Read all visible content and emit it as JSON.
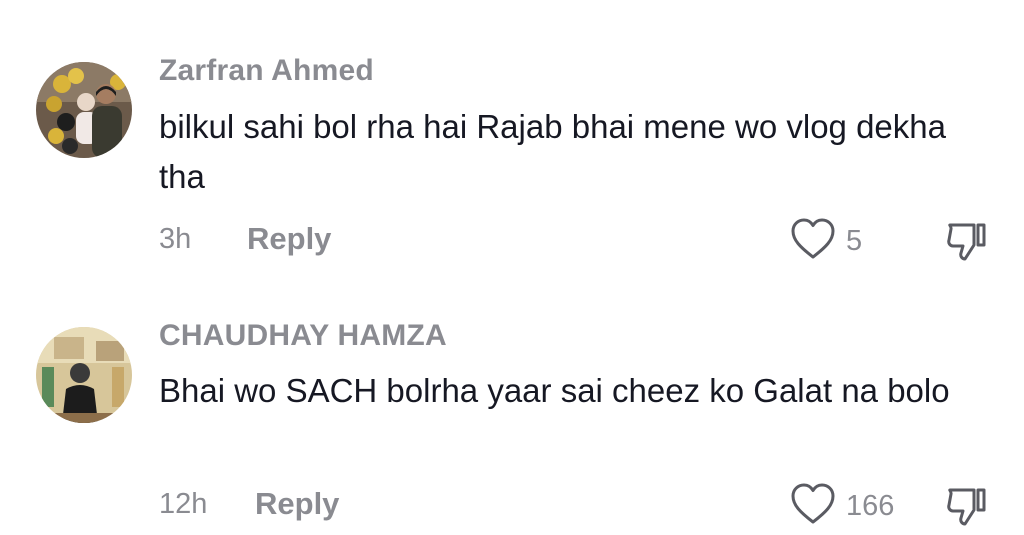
{
  "comments": [
    {
      "username": "Zarfran Ahmed",
      "text": "bilkul sahi bol rha hai Rajab bhai mene wo vlog dekha tha",
      "timestamp": "3h",
      "reply_label": "Reply",
      "like_count": "5",
      "avatar_icon": "user-avatar-photo",
      "like_icon": "heart-outline-icon",
      "dislike_icon": "thumbs-down-outline-icon"
    },
    {
      "username": "CHAUDHAY HAMZA",
      "text": "Bhai wo SACH bolrha yaar sai cheez ko Galat na bolo",
      "timestamp": "12h",
      "reply_label": "Reply",
      "like_count": "166",
      "avatar_icon": "user-avatar-photo",
      "like_icon": "heart-outline-icon",
      "dislike_icon": "thumbs-down-outline-icon"
    }
  ],
  "colors": {
    "text_primary": "#161823",
    "text_secondary": "#8a8b91",
    "background": "#ffffff"
  }
}
